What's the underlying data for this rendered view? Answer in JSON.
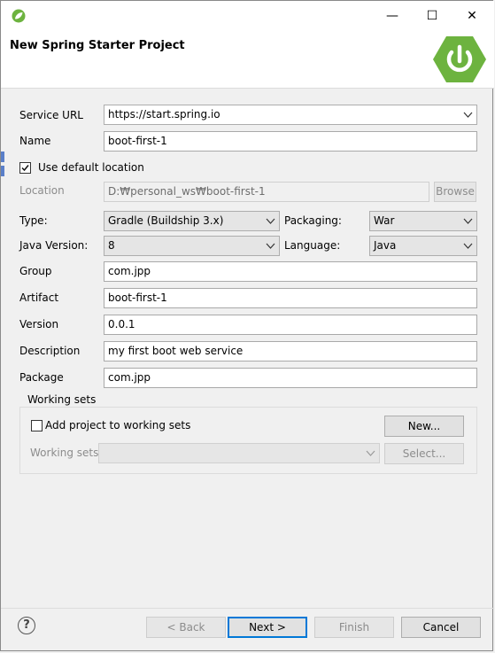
{
  "window": {
    "min_glyph": "—",
    "max_glyph": "☐",
    "close_glyph": "✕"
  },
  "header": {
    "title": "New Spring Starter Project"
  },
  "form": {
    "service_url_label": "Service URL",
    "service_url_value": "https://start.spring.io",
    "name_label": "Name",
    "name_value": "boot-first-1",
    "use_default_location_label": "Use default location",
    "use_default_location_checked": true,
    "location_label": "Location",
    "location_value": "D:₩personal_ws₩boot-first-1",
    "browse_label": "Browse",
    "type_label": "Type:",
    "type_value": "Gradle (Buildship 3.x)",
    "packaging_label": "Packaging:",
    "packaging_value": "War",
    "java_version_label": "Java Version:",
    "java_version_value": "8",
    "language_label": "Language:",
    "language_value": "Java",
    "group_label": "Group",
    "group_value": "com.jpp",
    "artifact_label": "Artifact",
    "artifact_value": "boot-first-1",
    "version_label": "Version",
    "version_value": "0.0.1",
    "description_label": "Description",
    "description_value": "my first boot web service",
    "package_label": "Package",
    "package_value": "com.jpp"
  },
  "working_sets": {
    "title": "Working sets",
    "add_label": "Add project to working sets",
    "add_checked": false,
    "new_label": "New...",
    "sets_label": "Working sets:",
    "sets_value": "",
    "select_label": "Select..."
  },
  "footer": {
    "help_glyph": "?",
    "back_label": "< Back",
    "next_label": "Next >",
    "finish_label": "Finish",
    "cancel_label": "Cancel"
  },
  "colors": {
    "spring_green": "#6db33f",
    "default_button_border": "#0078d7"
  }
}
